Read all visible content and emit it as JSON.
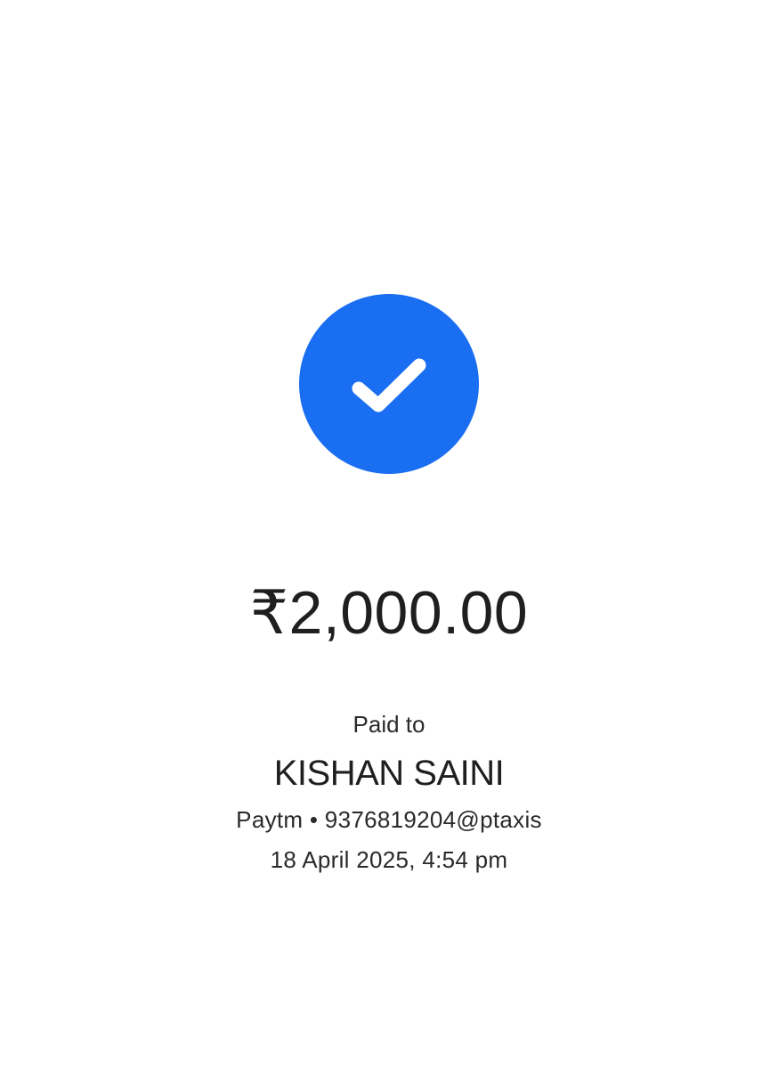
{
  "status": {
    "icon": "check-icon",
    "accent_color": "#1a6ef2"
  },
  "payment": {
    "amount": "₹2,000.00",
    "paid_to_label": "Paid to",
    "payee_name": "KISHAN SAINI",
    "payee_upi": "Paytm • 9376819204@ptaxis",
    "timestamp": "18 April 2025, 4:54 pm"
  }
}
